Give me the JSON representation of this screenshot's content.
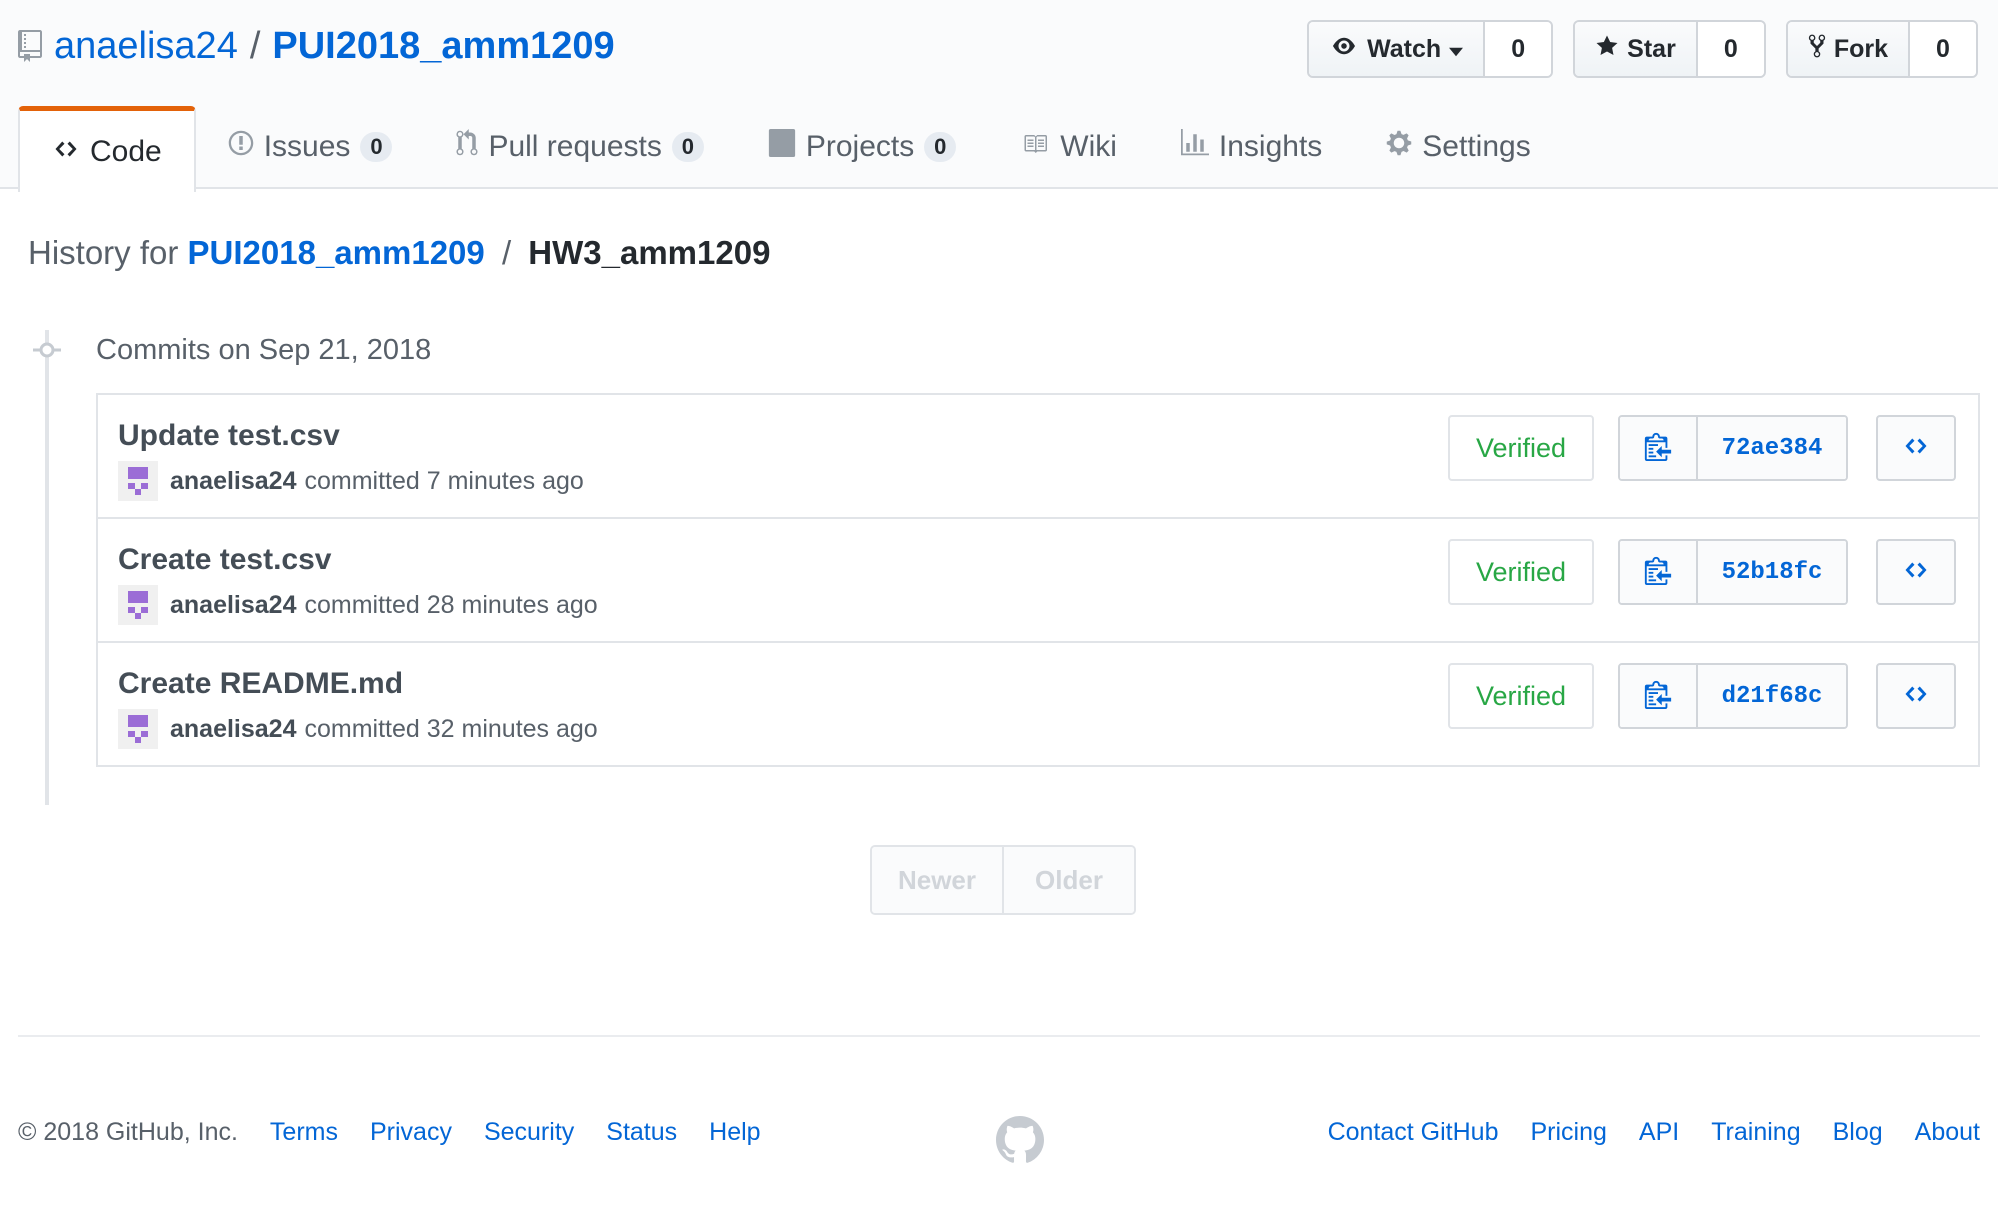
{
  "repo": {
    "owner": "anaelisa24",
    "separator": "/",
    "name": "PUI2018_amm1209"
  },
  "actions": {
    "watch": {
      "label": "Watch",
      "count": "0"
    },
    "star": {
      "label": "Star",
      "count": "0"
    },
    "fork": {
      "label": "Fork",
      "count": "0"
    }
  },
  "nav": {
    "code": {
      "label": "Code"
    },
    "issues": {
      "label": "Issues",
      "count": "0"
    },
    "pulls": {
      "label": "Pull requests",
      "count": "0"
    },
    "projects": {
      "label": "Projects",
      "count": "0"
    },
    "wiki": {
      "label": "Wiki"
    },
    "insights": {
      "label": "Insights"
    },
    "settings": {
      "label": "Settings"
    }
  },
  "history": {
    "prefix": "History for",
    "repo": "PUI2018_amm1209",
    "separator": "/",
    "path": "HW3_amm1209"
  },
  "commits_heading": "Commits on Sep 21, 2018",
  "commits": [
    {
      "title": "Update test.csv",
      "author": "anaelisa24",
      "time": "committed 7 minutes ago",
      "verified": "Verified",
      "sha": "72ae384"
    },
    {
      "title": "Create test.csv",
      "author": "anaelisa24",
      "time": "committed 28 minutes ago",
      "verified": "Verified",
      "sha": "52b18fc"
    },
    {
      "title": "Create README.md",
      "author": "anaelisa24",
      "time": "committed 32 minutes ago",
      "verified": "Verified",
      "sha": "d21f68c"
    }
  ],
  "pagination": {
    "newer": "Newer",
    "older": "Older"
  },
  "footer": {
    "copyright": "© 2018 GitHub, Inc.",
    "left_links": [
      "Terms",
      "Privacy",
      "Security",
      "Status",
      "Help"
    ],
    "right_links": [
      "Contact GitHub",
      "Pricing",
      "API",
      "Training",
      "Blog",
      "About"
    ]
  },
  "colors": {
    "link": "#0366d6",
    "verified": "#28a745",
    "selected_tab_accent": "#e36209",
    "avatar": "#9b6dd6"
  },
  "icons": [
    "repo-icon",
    "eye-icon",
    "caret-down-icon",
    "star-icon",
    "fork-icon",
    "code-icon",
    "issue-icon",
    "pull-request-icon",
    "project-icon",
    "wiki-icon",
    "graph-icon",
    "gear-icon",
    "commit-icon",
    "clippy-icon",
    "browse-code-icon",
    "github-mark-icon"
  ]
}
